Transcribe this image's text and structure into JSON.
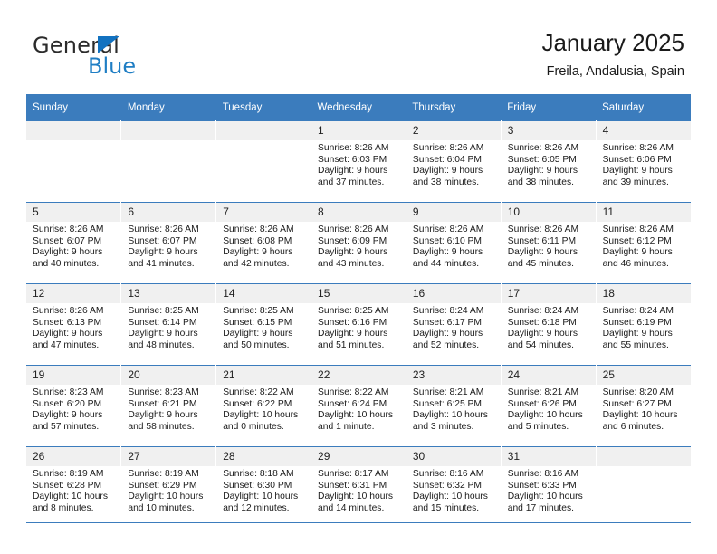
{
  "brand": {
    "name_part1": "General",
    "name_part2": "Blue",
    "accent_color": "#1f7ec4"
  },
  "header": {
    "title": "January 2025",
    "subtitle": "Freila, Andalusia, Spain"
  },
  "calendar": {
    "header_bg": "#3b7cbd",
    "daynum_bg": "#f0f0f0",
    "weekdays": [
      "Sunday",
      "Monday",
      "Tuesday",
      "Wednesday",
      "Thursday",
      "Friday",
      "Saturday"
    ],
    "weeks": [
      [
        {
          "empty": true
        },
        {
          "empty": true
        },
        {
          "empty": true
        },
        {
          "day": "1",
          "sunrise": "Sunrise: 8:26 AM",
          "sunset": "Sunset: 6:03 PM",
          "daylight1": "Daylight: 9 hours",
          "daylight2": "and 37 minutes."
        },
        {
          "day": "2",
          "sunrise": "Sunrise: 8:26 AM",
          "sunset": "Sunset: 6:04 PM",
          "daylight1": "Daylight: 9 hours",
          "daylight2": "and 38 minutes."
        },
        {
          "day": "3",
          "sunrise": "Sunrise: 8:26 AM",
          "sunset": "Sunset: 6:05 PM",
          "daylight1": "Daylight: 9 hours",
          "daylight2": "and 38 minutes."
        },
        {
          "day": "4",
          "sunrise": "Sunrise: 8:26 AM",
          "sunset": "Sunset: 6:06 PM",
          "daylight1": "Daylight: 9 hours",
          "daylight2": "and 39 minutes."
        }
      ],
      [
        {
          "day": "5",
          "sunrise": "Sunrise: 8:26 AM",
          "sunset": "Sunset: 6:07 PM",
          "daylight1": "Daylight: 9 hours",
          "daylight2": "and 40 minutes."
        },
        {
          "day": "6",
          "sunrise": "Sunrise: 8:26 AM",
          "sunset": "Sunset: 6:07 PM",
          "daylight1": "Daylight: 9 hours",
          "daylight2": "and 41 minutes."
        },
        {
          "day": "7",
          "sunrise": "Sunrise: 8:26 AM",
          "sunset": "Sunset: 6:08 PM",
          "daylight1": "Daylight: 9 hours",
          "daylight2": "and 42 minutes."
        },
        {
          "day": "8",
          "sunrise": "Sunrise: 8:26 AM",
          "sunset": "Sunset: 6:09 PM",
          "daylight1": "Daylight: 9 hours",
          "daylight2": "and 43 minutes."
        },
        {
          "day": "9",
          "sunrise": "Sunrise: 8:26 AM",
          "sunset": "Sunset: 6:10 PM",
          "daylight1": "Daylight: 9 hours",
          "daylight2": "and 44 minutes."
        },
        {
          "day": "10",
          "sunrise": "Sunrise: 8:26 AM",
          "sunset": "Sunset: 6:11 PM",
          "daylight1": "Daylight: 9 hours",
          "daylight2": "and 45 minutes."
        },
        {
          "day": "11",
          "sunrise": "Sunrise: 8:26 AM",
          "sunset": "Sunset: 6:12 PM",
          "daylight1": "Daylight: 9 hours",
          "daylight2": "and 46 minutes."
        }
      ],
      [
        {
          "day": "12",
          "sunrise": "Sunrise: 8:26 AM",
          "sunset": "Sunset: 6:13 PM",
          "daylight1": "Daylight: 9 hours",
          "daylight2": "and 47 minutes."
        },
        {
          "day": "13",
          "sunrise": "Sunrise: 8:25 AM",
          "sunset": "Sunset: 6:14 PM",
          "daylight1": "Daylight: 9 hours",
          "daylight2": "and 48 minutes."
        },
        {
          "day": "14",
          "sunrise": "Sunrise: 8:25 AM",
          "sunset": "Sunset: 6:15 PM",
          "daylight1": "Daylight: 9 hours",
          "daylight2": "and 50 minutes."
        },
        {
          "day": "15",
          "sunrise": "Sunrise: 8:25 AM",
          "sunset": "Sunset: 6:16 PM",
          "daylight1": "Daylight: 9 hours",
          "daylight2": "and 51 minutes."
        },
        {
          "day": "16",
          "sunrise": "Sunrise: 8:24 AM",
          "sunset": "Sunset: 6:17 PM",
          "daylight1": "Daylight: 9 hours",
          "daylight2": "and 52 minutes."
        },
        {
          "day": "17",
          "sunrise": "Sunrise: 8:24 AM",
          "sunset": "Sunset: 6:18 PM",
          "daylight1": "Daylight: 9 hours",
          "daylight2": "and 54 minutes."
        },
        {
          "day": "18",
          "sunrise": "Sunrise: 8:24 AM",
          "sunset": "Sunset: 6:19 PM",
          "daylight1": "Daylight: 9 hours",
          "daylight2": "and 55 minutes."
        }
      ],
      [
        {
          "day": "19",
          "sunrise": "Sunrise: 8:23 AM",
          "sunset": "Sunset: 6:20 PM",
          "daylight1": "Daylight: 9 hours",
          "daylight2": "and 57 minutes."
        },
        {
          "day": "20",
          "sunrise": "Sunrise: 8:23 AM",
          "sunset": "Sunset: 6:21 PM",
          "daylight1": "Daylight: 9 hours",
          "daylight2": "and 58 minutes."
        },
        {
          "day": "21",
          "sunrise": "Sunrise: 8:22 AM",
          "sunset": "Sunset: 6:22 PM",
          "daylight1": "Daylight: 10 hours",
          "daylight2": "and 0 minutes."
        },
        {
          "day": "22",
          "sunrise": "Sunrise: 8:22 AM",
          "sunset": "Sunset: 6:24 PM",
          "daylight1": "Daylight: 10 hours",
          "daylight2": "and 1 minute."
        },
        {
          "day": "23",
          "sunrise": "Sunrise: 8:21 AM",
          "sunset": "Sunset: 6:25 PM",
          "daylight1": "Daylight: 10 hours",
          "daylight2": "and 3 minutes."
        },
        {
          "day": "24",
          "sunrise": "Sunrise: 8:21 AM",
          "sunset": "Sunset: 6:26 PM",
          "daylight1": "Daylight: 10 hours",
          "daylight2": "and 5 minutes."
        },
        {
          "day": "25",
          "sunrise": "Sunrise: 8:20 AM",
          "sunset": "Sunset: 6:27 PM",
          "daylight1": "Daylight: 10 hours",
          "daylight2": "and 6 minutes."
        }
      ],
      [
        {
          "day": "26",
          "sunrise": "Sunrise: 8:19 AM",
          "sunset": "Sunset: 6:28 PM",
          "daylight1": "Daylight: 10 hours",
          "daylight2": "and 8 minutes."
        },
        {
          "day": "27",
          "sunrise": "Sunrise: 8:19 AM",
          "sunset": "Sunset: 6:29 PM",
          "daylight1": "Daylight: 10 hours",
          "daylight2": "and 10 minutes."
        },
        {
          "day": "28",
          "sunrise": "Sunrise: 8:18 AM",
          "sunset": "Sunset: 6:30 PM",
          "daylight1": "Daylight: 10 hours",
          "daylight2": "and 12 minutes."
        },
        {
          "day": "29",
          "sunrise": "Sunrise: 8:17 AM",
          "sunset": "Sunset: 6:31 PM",
          "daylight1": "Daylight: 10 hours",
          "daylight2": "and 14 minutes."
        },
        {
          "day": "30",
          "sunrise": "Sunrise: 8:16 AM",
          "sunset": "Sunset: 6:32 PM",
          "daylight1": "Daylight: 10 hours",
          "daylight2": "and 15 minutes."
        },
        {
          "day": "31",
          "sunrise": "Sunrise: 8:16 AM",
          "sunset": "Sunset: 6:33 PM",
          "daylight1": "Daylight: 10 hours",
          "daylight2": "and 17 minutes."
        },
        {
          "empty": true
        }
      ]
    ]
  }
}
